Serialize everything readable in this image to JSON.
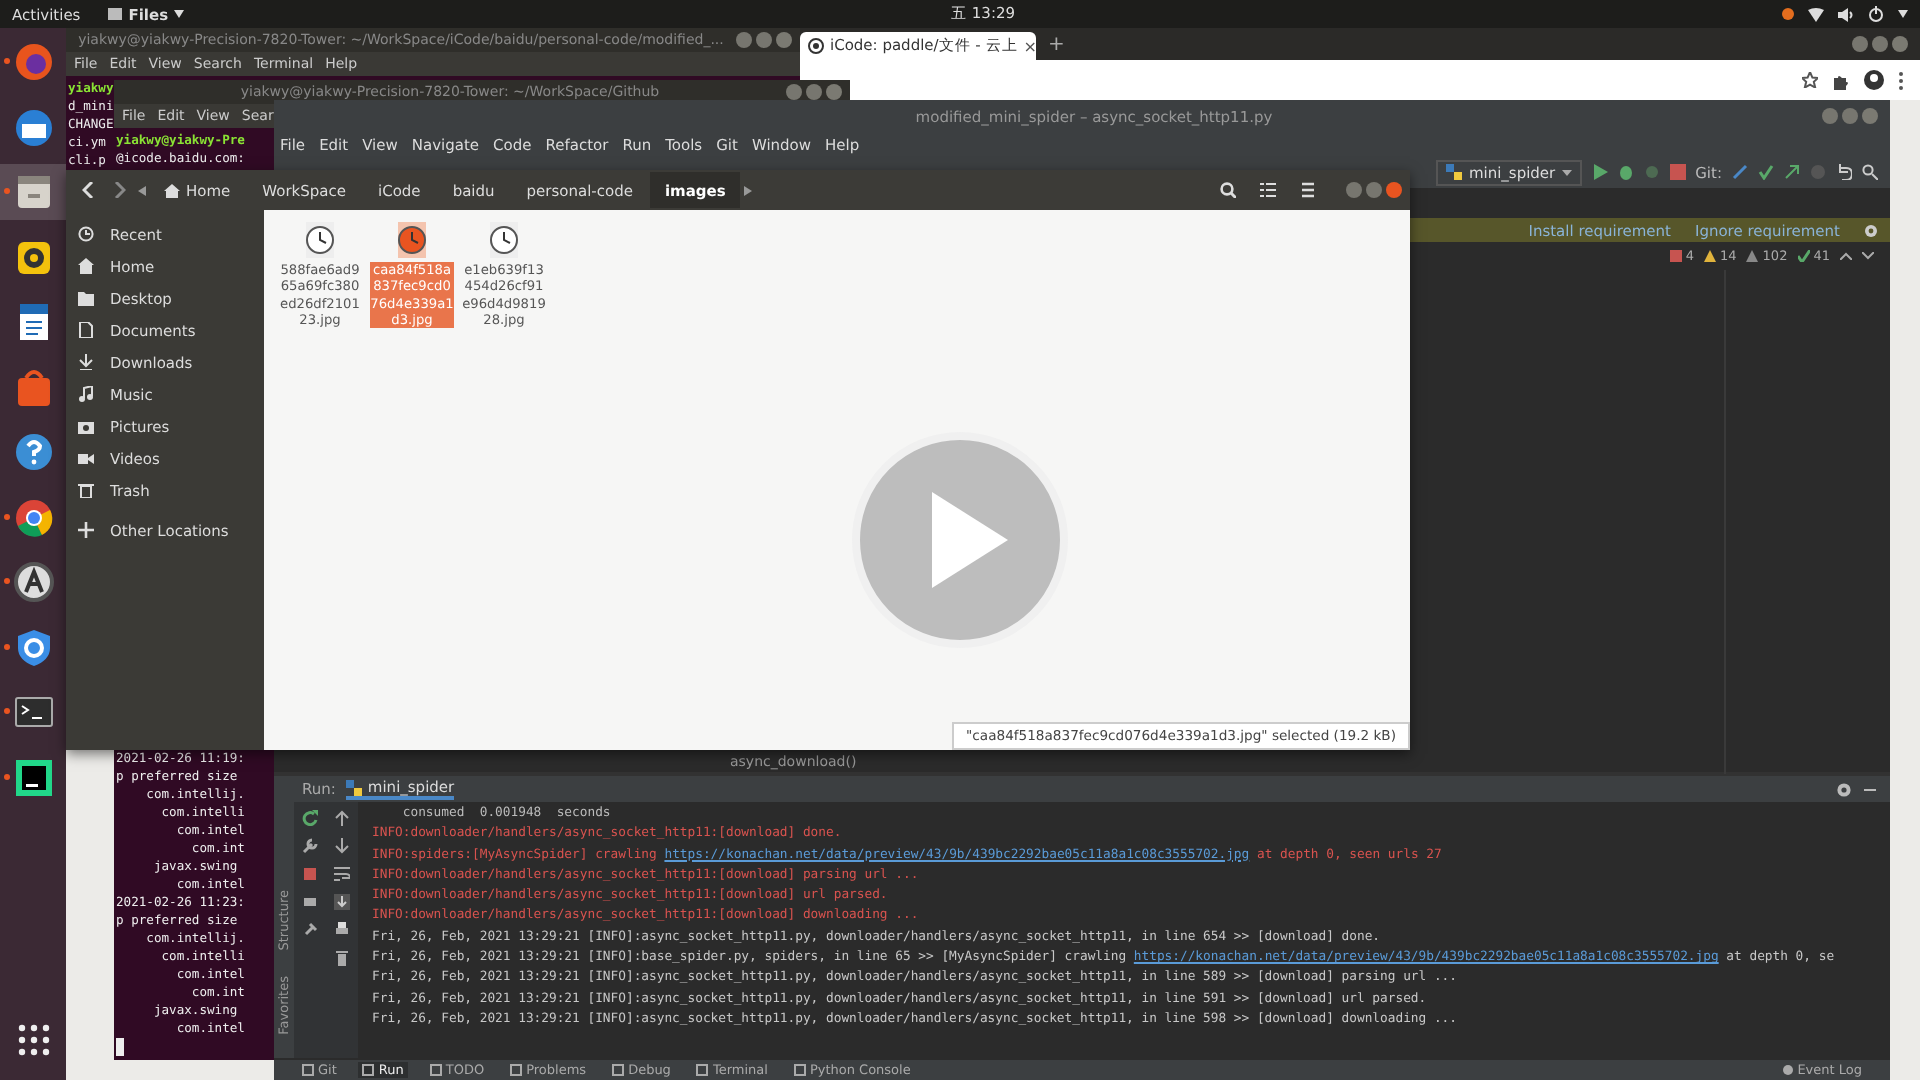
{
  "top_bar": {
    "activities": "Activities",
    "app_menu": "Files",
    "clock": "五 13:29"
  },
  "dock": {
    "items": [
      {
        "kind": "firefox",
        "running": true
      },
      {
        "kind": "mail",
        "running": false
      },
      {
        "kind": "files",
        "running": true
      },
      {
        "kind": "audio",
        "running": false
      },
      {
        "kind": "writer",
        "running": false
      },
      {
        "kind": "store",
        "running": false
      },
      {
        "kind": "help",
        "running": false
      },
      {
        "kind": "chrome",
        "running": true
      },
      {
        "kind": "font",
        "running": true
      },
      {
        "kind": "shield",
        "running": true
      },
      {
        "kind": "terminal",
        "running": true
      },
      {
        "kind": "pycharm",
        "running": true
      },
      {
        "kind": "apps",
        "running": false
      }
    ]
  },
  "terminals": [
    {
      "title": "yiakwy@yiakwy-Precision-7820-Tower: ~/WorkSpace/iCode/baidu/personal-code/modified_...",
      "menu": [
        "File",
        "Edit",
        "View",
        "Search",
        "Terminal",
        "Help"
      ],
      "lines": [
        "yiakwy",
        "d_mini",
        "CHANGE",
        "ci.ym",
        "cli.p"
      ]
    },
    {
      "title": "yiakwy@yiakwy-Precision-7820-Tower: ~/WorkSpace/Github",
      "menu": [
        "File",
        "Edit",
        "View",
        "Sear"
      ],
      "lines": [
        "yiakwy@yiakwy-Pre",
        "@icode.baidu.com:"
      ],
      "bottom_lines": [
        "2021-02-26 11:19:",
        "p preferred size",
        "    com.intellij.",
        "      com.intelli",
        "        com.intel",
        "          com.int",
        "     javax.swing",
        "        com.intel",
        "2021-02-26 11:23:",
        "p preferred size",
        "    com.intellij.",
        "      com.intelli",
        "        com.intel",
        "          com.int",
        "     javax.swing",
        "        com.intel"
      ]
    }
  ],
  "browser": {
    "tab": "iCode: paddle/文件 - 云上",
    "tab_close": "×",
    "new_tab": "+"
  },
  "ide": {
    "title": "modified_mini_spider – async_socket_http11.py",
    "menu": [
      "File",
      "Edit",
      "View",
      "Navigate",
      "Code",
      "Refactor",
      "Run",
      "Tools",
      "Git",
      "Window",
      "Help"
    ],
    "run_config": "mini_spider",
    "git_label": "Git:",
    "banner": {
      "install": "Install requirement",
      "ignore": "Ignore requirement"
    },
    "inspections": [
      {
        "kind": "error",
        "count": "4"
      },
      {
        "kind": "warning",
        "count": "14"
      },
      {
        "kind": "weak",
        "count": "102"
      },
      {
        "kind": "typo",
        "count": "41"
      }
    ],
    "editor_hint": "async_download()",
    "run_panel": {
      "label": "Run:",
      "tab": "mini_spider",
      "side_labels": [
        "Structure",
        "Favorites"
      ],
      "lines": [
        {
          "kind": "plain",
          "text": "    consumed  0.001948  seconds"
        },
        {
          "kind": "stderr",
          "text": "INFO:downloader/handlers/async_socket_http11:[download] done."
        },
        {
          "kind": "stderr",
          "text": "INFO:spiders:[MyAsyncSpider] crawling ",
          "link": "https://konachan.net/data/preview/43/9b/439bc2292bae05c11a8a1c08c3555702.jpg",
          "tail": " at depth 0, seen urls 27"
        },
        {
          "kind": "stderr",
          "text": "INFO:downloader/handlers/async_socket_http11:[download] parsing url ..."
        },
        {
          "kind": "stderr",
          "text": "INFO:downloader/handlers/async_socket_http11:[download] url parsed."
        },
        {
          "kind": "stderr",
          "text": "INFO:downloader/handlers/async_socket_http11:[download] downloading ..."
        },
        {
          "kind": "stdout",
          "text": "Fri, 26, Feb, 2021 13:29:21 [INFO]:async_socket_http11.py, downloader/handlers/async_socket_http11, in line 654 >> [download] done."
        },
        {
          "kind": "stdout",
          "text": "Fri, 26, Feb, 2021 13:29:21 [INFO]:base_spider.py, spiders, in line 65 >> [MyAsyncSpider] crawling ",
          "link": "https://konachan.net/data/preview/43/9b/439bc2292bae05c11a8a1c08c3555702.jpg",
          "tail": " at depth 0, se"
        },
        {
          "kind": "stdout",
          "text": "Fri, 26, Feb, 2021 13:29:21 [INFO]:async_socket_http11.py, downloader/handlers/async_socket_http11, in line 589 >> [download] parsing url ..."
        },
        {
          "kind": "stdout",
          "text": "Fri, 26, Feb, 2021 13:29:21 [INFO]:async_socket_http11.py, downloader/handlers/async_socket_http11, in line 591 >> [download] url parsed."
        },
        {
          "kind": "stdout",
          "text": "Fri, 26, Feb, 2021 13:29:21 [INFO]:async_socket_http11.py, downloader/handlers/async_socket_http11, in line 598 >> [download] downloading ..."
        }
      ]
    },
    "tool_tabs": [
      {
        "label": "Git",
        "selected": false
      },
      {
        "label": "Run",
        "selected": true
      },
      {
        "label": "TODO",
        "selected": false
      },
      {
        "label": "Problems",
        "selected": false
      },
      {
        "label": "Debug",
        "selected": false
      },
      {
        "label": "Terminal",
        "selected": false
      },
      {
        "label": "Python Console",
        "selected": false
      }
    ],
    "event_log": "Event Log"
  },
  "files": {
    "path": [
      {
        "label": "Home",
        "selected": false
      },
      {
        "label": "WorkSpace",
        "selected": false
      },
      {
        "label": "iCode",
        "selected": false
      },
      {
        "label": "baidu",
        "selected": false
      },
      {
        "label": "personal-code",
        "selected": false
      },
      {
        "label": "images",
        "selected": true
      }
    ],
    "sidebar": [
      {
        "kind": "recent",
        "label": "Recent",
        "selected": false
      },
      {
        "kind": "home",
        "label": "Home",
        "selected": false
      },
      {
        "kind": "folder",
        "label": "Desktop",
        "selected": false
      },
      {
        "kind": "document",
        "label": "Documents",
        "selected": false
      },
      {
        "kind": "download",
        "label": "Downloads",
        "selected": false
      },
      {
        "kind": "music",
        "label": "Music",
        "selected": false
      },
      {
        "kind": "camera",
        "label": "Pictures",
        "selected": false
      },
      {
        "kind": "video",
        "label": "Videos",
        "selected": false
      },
      {
        "kind": "trash",
        "label": "Trash",
        "selected": false
      },
      {
        "kind": "plus",
        "label": "Other Locations",
        "selected": false
      }
    ],
    "items": [
      {
        "name": "588fae6ad965a69fc380ed26df210123.jpg",
        "selected": false
      },
      {
        "name": "caa84f518a837fec9cd076d4e339a1d3.jpg",
        "selected": true
      },
      {
        "name": "e1eb639f13454d26cf91e96d4d981928.jpg",
        "selected": false
      }
    ],
    "status": "\"caa84f518a837fec9cd076d4e339a1d3.jpg\" selected  (19.2 kB)"
  }
}
